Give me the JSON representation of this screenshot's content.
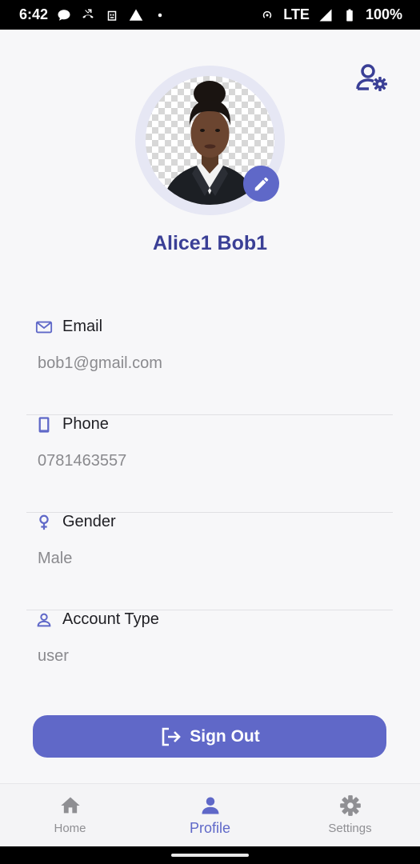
{
  "status_bar": {
    "time": "6:42",
    "network": "LTE",
    "battery": "100%"
  },
  "profile": {
    "name": "Alice1 Bob1"
  },
  "fields": [
    {
      "icon": "mail-icon",
      "label": "Email",
      "value": "bob1@gmail.com"
    },
    {
      "icon": "phone-icon",
      "label": "Phone",
      "value": "0781463557"
    },
    {
      "icon": "female-icon",
      "label": "Gender",
      "value": "Male"
    },
    {
      "icon": "person-icon",
      "label": "Account Type",
      "value": "user"
    }
  ],
  "actions": {
    "sign_out_label": "Sign Out"
  },
  "bottom_nav": {
    "items": [
      {
        "label": "Home",
        "icon": "home-icon",
        "active": false
      },
      {
        "label": "Profile",
        "icon": "person-icon",
        "active": true
      },
      {
        "label": "Settings",
        "icon": "gear-icon",
        "active": false
      }
    ]
  },
  "colors": {
    "accent": "#5f68c8",
    "accent_dark": "#3a3f96",
    "background": "#f7f7f9"
  }
}
